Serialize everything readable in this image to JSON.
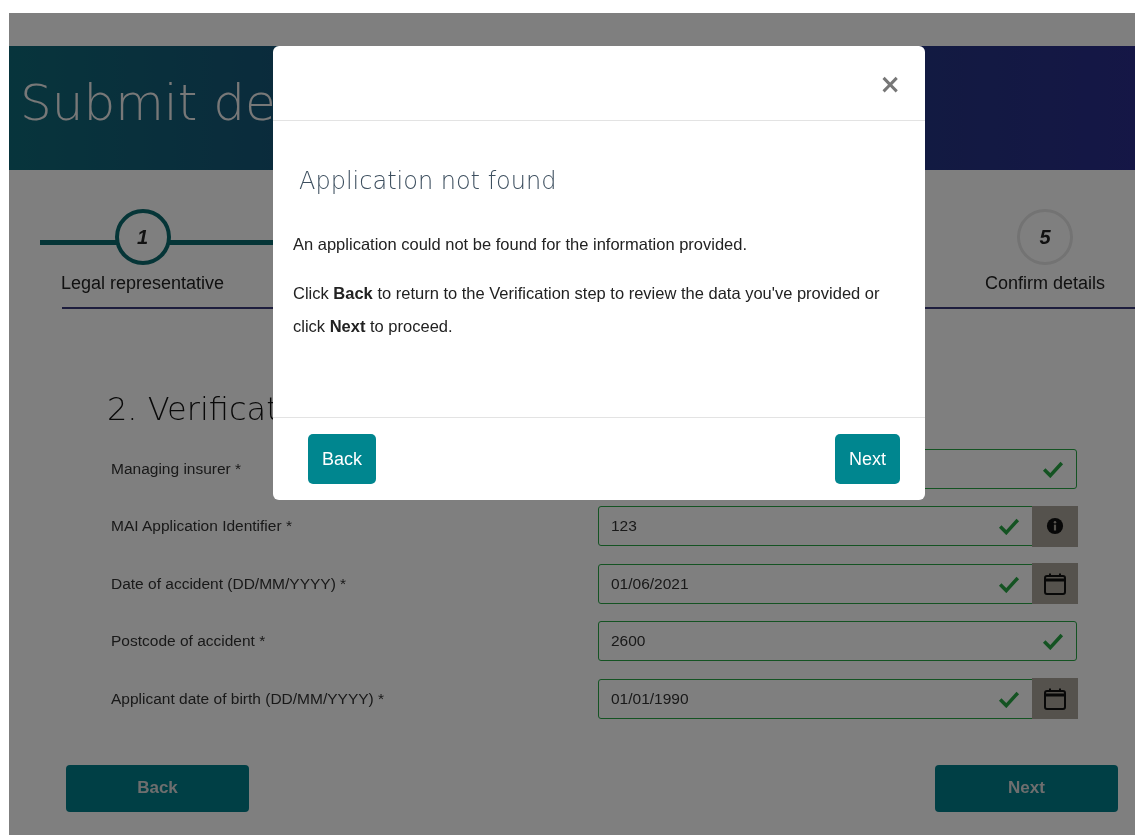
{
  "page": {
    "banner_title": "Submit de",
    "steps": [
      {
        "number": "1",
        "label": "Legal representative",
        "active": true
      },
      {
        "number": "5",
        "label": "Confirm details",
        "active": false
      }
    ],
    "section_title": "2. Verificat",
    "fields": [
      {
        "label": "Managing insurer *",
        "kind": "plain",
        "valid": true
      },
      {
        "label": "MAI Application Identifier *",
        "value": "123",
        "kind": "info",
        "valid": true
      },
      {
        "label": "Date of accident (DD/MM/YYYY) *",
        "value": "01/06/2021",
        "kind": "date",
        "valid": true
      },
      {
        "label": "Postcode of accident *",
        "value": "2600",
        "kind": "plain",
        "valid": true
      },
      {
        "label": "Applicant date of birth (DD/MM/YYYY) *",
        "value": "01/01/1990",
        "kind": "date",
        "valid": true
      }
    ],
    "buttons": [
      "Back",
      "Next"
    ]
  },
  "modal": {
    "close": "×",
    "title": "Application not found",
    "paragraphs": [
      "An application could not be found for the information provided.",
      "Click **Back** to return to the Verification step to review the data you've provided or click **Next** to proceed."
    ],
    "buttons": [
      "Back",
      "Next"
    ]
  }
}
